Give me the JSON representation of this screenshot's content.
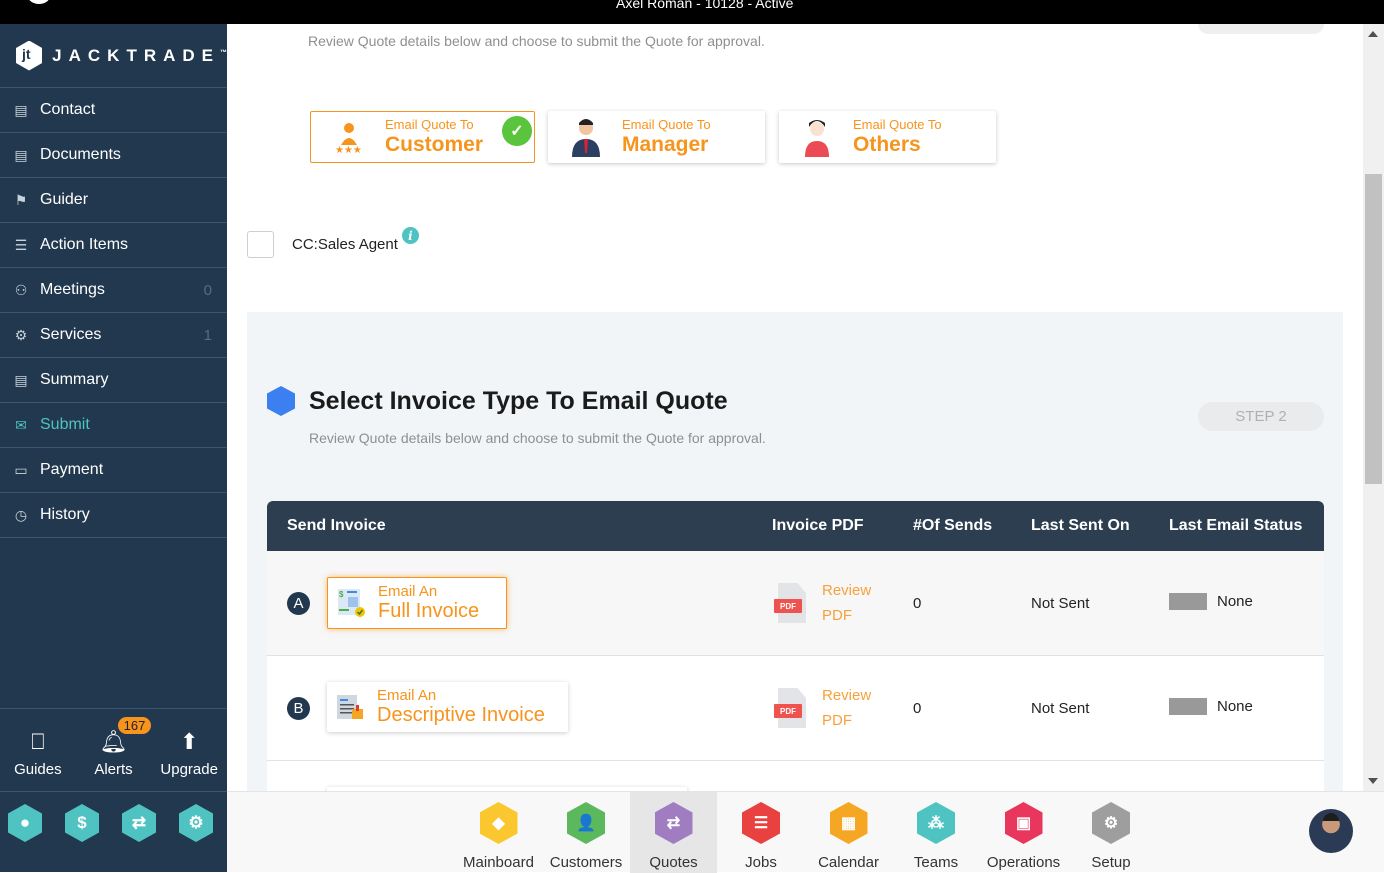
{
  "window": {
    "title": "Axel Roman - 10128 - Active"
  },
  "brand": {
    "name": "JACKTRADE",
    "tm": "™"
  },
  "sidebar": {
    "items": [
      {
        "label": "Contact",
        "icon": "contact-book-icon",
        "glyph": "▤",
        "count": null
      },
      {
        "label": "Documents",
        "icon": "documents-icon",
        "glyph": "▤",
        "count": null
      },
      {
        "label": "Guider",
        "icon": "signpost-icon",
        "glyph": "⚑",
        "count": null
      },
      {
        "label": "Action Items",
        "icon": "clipboard-icon",
        "glyph": "☰",
        "count": null
      },
      {
        "label": "Meetings",
        "icon": "meetings-icon",
        "glyph": "⚇",
        "count": "0"
      },
      {
        "label": "Services",
        "icon": "services-icon",
        "glyph": "⚙",
        "count": "1"
      },
      {
        "label": "Summary",
        "icon": "summary-icon",
        "glyph": "▤",
        "count": null
      },
      {
        "label": "Submit",
        "icon": "submit-mail-icon",
        "glyph": "✉",
        "count": null,
        "active": true
      },
      {
        "label": "Payment",
        "icon": "payment-card-icon",
        "glyph": "▭",
        "count": null
      },
      {
        "label": "History",
        "icon": "history-icon",
        "glyph": "◷",
        "count": null
      }
    ],
    "bottom": [
      {
        "label": "Guides",
        "icon": "guides-book-icon",
        "glyph": "⎕"
      },
      {
        "label": "Alerts",
        "icon": "bell-icon",
        "glyph": "🔔",
        "badge": "167"
      },
      {
        "label": "Upgrade",
        "icon": "upgrade-arrow-icon",
        "glyph": "⬆"
      }
    ],
    "quick": [
      {
        "icon": "user-hex-icon",
        "glyph": "👤"
      },
      {
        "icon": "dollar-hex-icon",
        "glyph": "$"
      },
      {
        "icon": "quotes-hex-icon",
        "glyph": "⇄"
      },
      {
        "icon": "workflow-hex-icon",
        "glyph": "⚙"
      }
    ]
  },
  "step1": {
    "description": "Review Quote details below and choose to submit the Quote for approval.",
    "recipients": [
      {
        "small": "Email Quote To",
        "large": "Customer",
        "selected": true
      },
      {
        "small": "Email Quote To",
        "large": "Manager",
        "selected": false
      },
      {
        "small": "Email Quote To",
        "large": "Others",
        "selected": false
      }
    ],
    "cc_label": "CC:Sales Agent",
    "cc_checked": false
  },
  "step2": {
    "title": "Select Invoice Type To Email Quote",
    "description": "Review Quote details below and choose to submit the Quote for approval.",
    "step_label": "STEP 2",
    "columns": [
      "Send Invoice",
      "Invoice PDF",
      "#Of Sends",
      "Last Sent On",
      "Last Email Status"
    ],
    "rows": [
      {
        "letter": "A",
        "small": "Email An",
        "large": "Full Invoice",
        "selected": true,
        "pdf_tag": "PDF",
        "review1": "Review",
        "review2": "PDF",
        "sends": "0",
        "last_sent": "Not Sent",
        "status": "None",
        "status_color": "#999999"
      },
      {
        "letter": "B",
        "small": "Email An",
        "large": "Descriptive Invoice",
        "selected": false,
        "pdf_tag": "PDF",
        "review1": "Review",
        "review2": "PDF",
        "sends": "0",
        "last_sent": "Not Sent",
        "status": "None",
        "status_color": "#999999"
      }
    ]
  },
  "bottom_nav": [
    {
      "label": "Mainboard",
      "color": "#fbc72f",
      "glyph": "◆"
    },
    {
      "label": "Customers",
      "color": "#5cb85c",
      "glyph": "👤"
    },
    {
      "label": "Quotes",
      "color": "#a07dc0",
      "glyph": "⇄",
      "active": true
    },
    {
      "label": "Jobs",
      "color": "#e94040",
      "glyph": "☰"
    },
    {
      "label": "Calendar",
      "color": "#f5a623",
      "glyph": "▦"
    },
    {
      "label": "Teams",
      "color": "#4fc3c2",
      "glyph": "⁂"
    },
    {
      "label": "Operations",
      "color": "#e8365d",
      "glyph": "▣"
    },
    {
      "label": "Setup",
      "color": "#9e9e9e",
      "glyph": "⚙"
    }
  ],
  "colors": {
    "accent": "#f7941d",
    "sidebar": "#22384e",
    "teal": "#4fc3c2",
    "table_header": "#2c3e50"
  }
}
